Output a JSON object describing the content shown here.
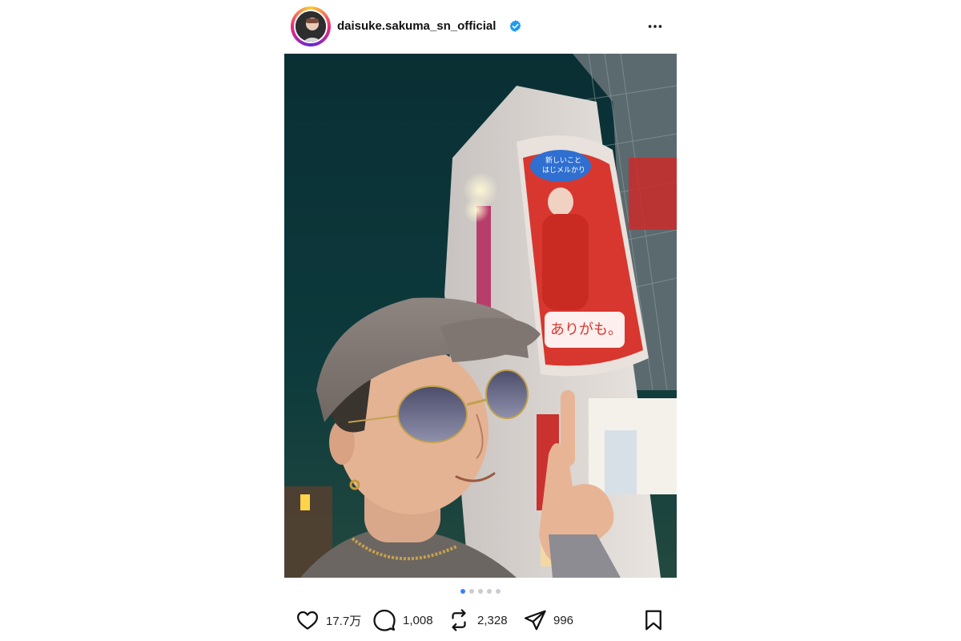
{
  "post": {
    "username": "daisuke.sakuma_sn_official",
    "verified": true,
    "more_icon": "more-horizontal-icon",
    "image_description_icon": "photo",
    "carousel": {
      "total": 5,
      "active_index": 0
    },
    "actions": {
      "likes": "17.7万",
      "comments": "1,008",
      "reposts": "2,328",
      "shares": "996"
    }
  },
  "colors": {
    "accent": "#3b82f6",
    "verified_blue": "#1d9bf0"
  }
}
